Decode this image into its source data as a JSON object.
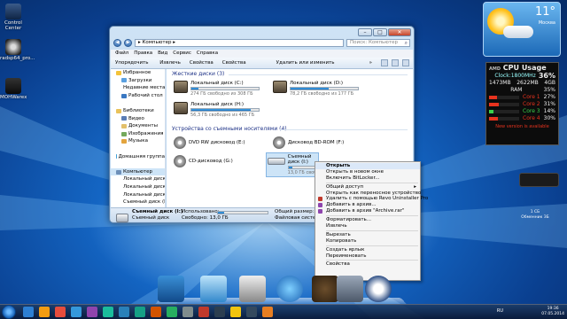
{
  "desktop_icons": [
    {
      "label": "Control Center"
    },
    {
      "label": "radsp64_pro..."
    },
    {
      "label": "MOHWarex"
    }
  ],
  "window": {
    "address": "▸ Компьютер ▸",
    "search_placeholder": "Поиск: Компьютер",
    "menu": [
      "Файл",
      "Правка",
      "Вид",
      "Сервис",
      "Справка"
    ],
    "toolbar": [
      "Упорядочить ▾",
      "Извлечь",
      "Свойства",
      "Свойства системы",
      "Удалить или изменить программу",
      "»"
    ],
    "nav": [
      {
        "label": "Избранное",
        "sub": false,
        "color": "#f3c33a"
      },
      {
        "label": "Загрузки",
        "sub": true,
        "color": "#5aa0e0"
      },
      {
        "label": "Недавние места",
        "sub": true,
        "color": "#7aa5d0"
      },
      {
        "label": "Рабочий стол",
        "sub": true,
        "color": "#3a78c2"
      },
      {
        "label": "",
        "sub": false,
        "color": ""
      },
      {
        "label": "Библиотеки",
        "sub": false,
        "color": "#e9c25a"
      },
      {
        "label": "Видео",
        "sub": true,
        "color": "#5a7db5"
      },
      {
        "label": "Документы",
        "sub": true,
        "color": "#e3c06b"
      },
      {
        "label": "Изображения",
        "sub": true,
        "color": "#74a95c"
      },
      {
        "label": "Музыка",
        "sub": true,
        "color": "#e3a43e"
      },
      {
        "label": "",
        "sub": false,
        "color": ""
      },
      {
        "label": "Домашняя группа",
        "sub": false,
        "color": "#3fa0d8"
      },
      {
        "label": "",
        "sub": false,
        "color": ""
      },
      {
        "label": "Компьютер",
        "sub": false,
        "color": "#6d8fb8",
        "selected": true
      },
      {
        "label": "Локальный диск",
        "sub": true,
        "color": "#8d7d62"
      },
      {
        "label": "Локальный диск",
        "sub": true,
        "color": "#8d7d62"
      },
      {
        "label": "Локальный диск",
        "sub": true,
        "color": "#8d7d62"
      },
      {
        "label": "Съемный диск (I:",
        "sub": true,
        "color": "#b0b8c2"
      }
    ],
    "hdd_group": "Жесткие диски (3)",
    "drives": [
      {
        "name": "Локальный диск (C:)",
        "free": "274 ГБ свободно из 308 ГБ",
        "fill": 0.11
      },
      {
        "name": "Локальный диск (D:)",
        "free": "78,2 ГБ свободно из 177 ГБ",
        "fill": 0.56
      },
      {
        "name": "Локальный диск (H:)",
        "free": "56,3 ГБ свободно из 465 ГБ",
        "fill": 0.88
      }
    ],
    "removable_group": "Устройства со съемными носителями (4)",
    "removable": [
      {
        "name": "DVD RW дисковод (E:)"
      },
      {
        "name": "Дисковод BD-ROM (F:)"
      },
      {
        "name": "CD-дисковод (G:)"
      },
      {
        "name": "Съемный диск (I:)",
        "free": "13,0 ГБ своб",
        "fill": 0.13
      }
    ],
    "details": {
      "name": "Съемный диск (I:)",
      "type": "Съемный диск",
      "used_label": "Использовано:",
      "free_label": "Свободно: 13,0 ГБ",
      "total_label": "Общий размер: 15,0 ГБ",
      "fs_label": "Файловая система: FAT32",
      "fill": 0.13
    }
  },
  "context_menu": [
    {
      "label": "Открыть",
      "bold": true
    },
    {
      "label": "Открыть в новом окне"
    },
    {
      "label": "Включить BitLocker..."
    },
    {
      "sep": true
    },
    {
      "label": "Общий доступ",
      "arrow": true
    },
    {
      "label": "Открыть как переносное устройство"
    },
    {
      "label": "Удалить с помощью Revo Uninstaller Pro",
      "icon": "#c0392b"
    },
    {
      "label": "Добавить в архив...",
      "icon": "#8e44ad"
    },
    {
      "label": "Добавить в архив \"Archive.rar\"",
      "icon": "#8e44ad"
    },
    {
      "sep": true
    },
    {
      "label": "Форматировать..."
    },
    {
      "label": "Извлечь"
    },
    {
      "sep": true
    },
    {
      "label": "Вырезать"
    },
    {
      "label": "Копировать"
    },
    {
      "sep": true
    },
    {
      "label": "Создать ярлык"
    },
    {
      "label": "Переименовать"
    },
    {
      "sep": true
    },
    {
      "label": "Свойства"
    }
  ],
  "weather": {
    "temp": "11°",
    "city": "Москва"
  },
  "cpu_gadget": {
    "title": "CPU Usage",
    "percent": "36%",
    "clock": "Clock:1800MHz",
    "rows": [
      {
        "a": "1473MB",
        "b": "2622MB",
        "c": "4GB"
      },
      {
        "a": "",
        "b": "RAM",
        "c": "35%"
      }
    ],
    "cores": [
      {
        "label": "Core 1",
        "val": "27%",
        "color": "#e8331e"
      },
      {
        "label": "Core 2",
        "val": "31%",
        "color": "#e8331e"
      },
      {
        "label": "Core 3",
        "val": "14%",
        "color": "#3ad14b"
      },
      {
        "label": "Core 4",
        "val": "30%",
        "color": "#e8331e"
      }
    ],
    "notice": "New version is available"
  },
  "small_gadget": {
    "line1": "1 СБ",
    "line2": "Обменник ЗБ"
  },
  "taskbar": {
    "lang": "RU",
    "time": "19:36",
    "date": "07.05.2014"
  },
  "colors": {
    "accent": "#1b72c0"
  }
}
